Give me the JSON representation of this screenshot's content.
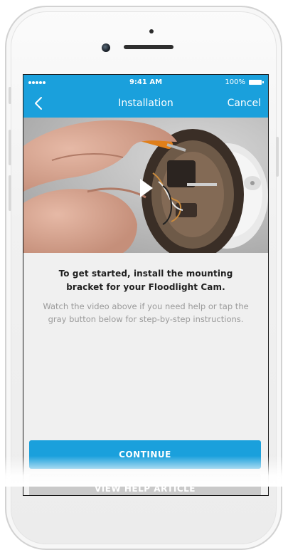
{
  "status_bar": {
    "time": "9:41 AM",
    "battery": "100%"
  },
  "nav": {
    "title": "Installation",
    "cancel": "Cancel",
    "back_icon": "chevron-left-icon"
  },
  "video": {
    "play_icon": "play-icon",
    "thumbnail": "hands installing floodlight cam mounting bracket with screwdriver"
  },
  "content": {
    "heading": "To get started, install the mounting bracket for your Floodlight Cam.",
    "body": "Watch the video above if you need help or tap the gray button below for step-by-step instructions."
  },
  "buttons": {
    "continue": "CONTINUE",
    "help": "VIEW HELP ARTICLE"
  },
  "colors": {
    "accent": "#1aa0dc",
    "secondary_button": "#c9c9c9",
    "background": "#f0f0f0"
  }
}
